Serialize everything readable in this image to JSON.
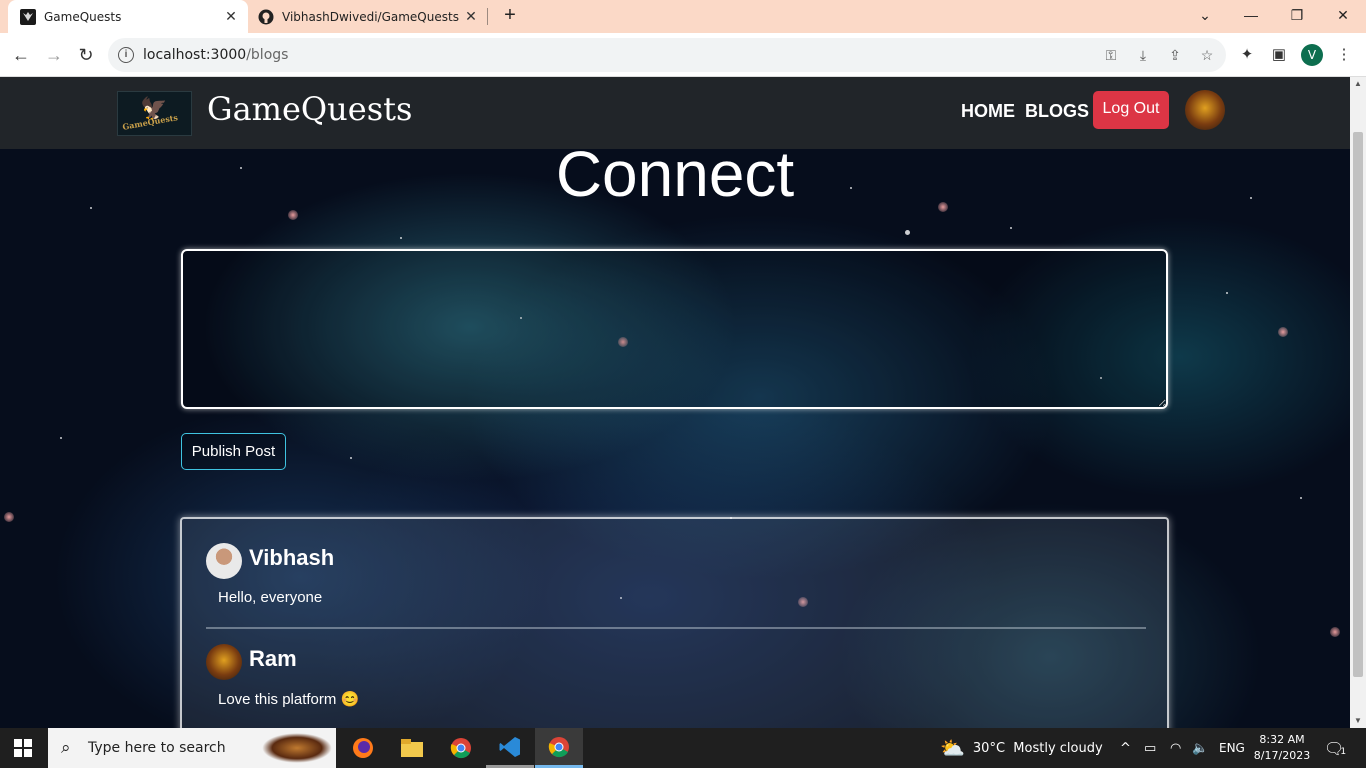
{
  "browser": {
    "tabs": [
      {
        "title": "GameQuests",
        "close": "✕"
      },
      {
        "title": "VibhashDwivedi/GameQuests",
        "close": "✕"
      }
    ],
    "new_tab": "+",
    "url_host": "localhost:3000",
    "url_path": "/blogs",
    "profile_initial": "V"
  },
  "site": {
    "brand": "GameQuests",
    "logo_text": "GameQuests",
    "nav": {
      "home": "HOME",
      "blogs": "BLOGS",
      "logout": "Log Out"
    },
    "heading": "Connect",
    "textarea_value": "",
    "publish_label": "Publish Post",
    "posts": [
      {
        "author": "Vibhash",
        "content": "Hello, everyone"
      },
      {
        "author": "Ram",
        "content": "Love this platform 😊"
      }
    ]
  },
  "taskbar": {
    "search_placeholder": "Type here to search",
    "weather": "30°C  Mostly cloudy",
    "language": "ENG",
    "time": "8:32 AM",
    "date": "8/17/2023",
    "notifications": "1"
  },
  "colors": {
    "logout": "#dc3545",
    "publish_border": "#3fc3e0",
    "navbar": "#212529",
    "tabbar": "#fbd9c7"
  }
}
